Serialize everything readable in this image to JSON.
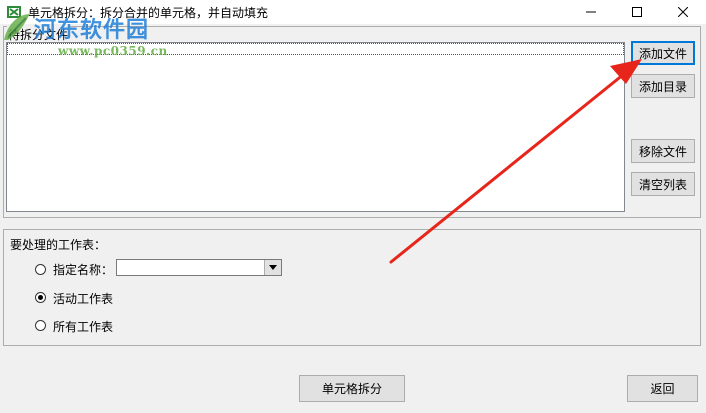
{
  "window": {
    "title": "单元格拆分：拆分合并的单元格，并自动填充",
    "controls": [
      "minimize",
      "maximize",
      "close"
    ]
  },
  "watermark": {
    "main": "河东软件园",
    "url": "www.pc0359.cn"
  },
  "file_group": {
    "label": "待拆分文件",
    "files": [],
    "buttons": {
      "add_file": "添加文件",
      "add_dir": "添加目录",
      "remove_file": "移除文件",
      "clear_list": "清空列表"
    }
  },
  "sheet_group": {
    "label": "要处理的工作表：",
    "options": [
      {
        "label": "指定名称：",
        "checked": false
      },
      {
        "label": "活动工作表",
        "checked": true
      },
      {
        "label": "所有工作表",
        "checked": false
      }
    ],
    "name_combo_value": ""
  },
  "footer": {
    "split_button": "单元格拆分",
    "back_button": "返回"
  },
  "colors": {
    "annotation_arrow": "#e8251a",
    "watermark_blue": "#1e7fd8",
    "watermark_green": "#6ab04c",
    "focus_blue": "#0078d7"
  }
}
